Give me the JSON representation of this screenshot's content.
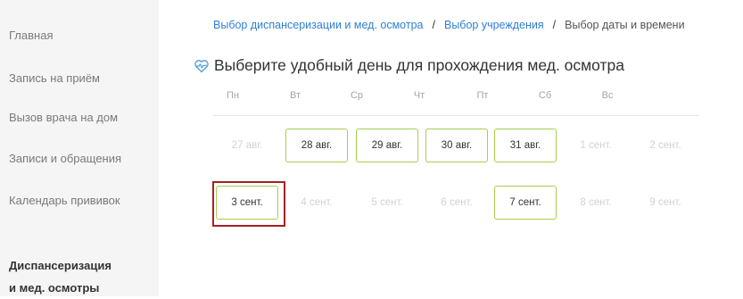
{
  "sidebar": {
    "items": [
      {
        "label": "Главная"
      },
      {
        "label": "Запись на приём"
      },
      {
        "label": "Вызов врача на дом"
      },
      {
        "label": "Записи и обращения"
      },
      {
        "label": "Календарь прививок"
      }
    ],
    "section": {
      "line1": "Диспансеризация",
      "line2": "и мед. осмотры"
    }
  },
  "breadcrumb": {
    "step1": "Выбор диспансеризации и мед. осмотра",
    "step2": "Выбор учреждения",
    "current": "Выбор даты и времени",
    "separator": "/"
  },
  "title": "Выберите удобный день для прохождения мед. осмотра",
  "calendar": {
    "weekdays": [
      "Пн",
      "Вт",
      "Ср",
      "Чт",
      "Пт",
      "Сб",
      "Вс"
    ],
    "weeks": [
      [
        {
          "label": "27 авг.",
          "state": "disabled"
        },
        {
          "label": "28 авг.",
          "state": "available"
        },
        {
          "label": "29 авг.",
          "state": "available"
        },
        {
          "label": "30 авг.",
          "state": "available"
        },
        {
          "label": "31 авг.",
          "state": "available"
        },
        {
          "label": "1 сент.",
          "state": "disabled"
        },
        {
          "label": "2 сент.",
          "state": "disabled"
        }
      ],
      [
        {
          "label": "3 сент.",
          "state": "available"
        },
        {
          "label": "4 сент.",
          "state": "disabled"
        },
        {
          "label": "5 сент.",
          "state": "disabled"
        },
        {
          "label": "6 сент.",
          "state": "disabled"
        },
        {
          "label": "7 сент.",
          "state": "available"
        },
        {
          "label": "8 сент.",
          "state": "disabled"
        },
        {
          "label": "9 сент.",
          "state": "disabled"
        }
      ]
    ]
  },
  "colors": {
    "link": "#2f7fd3",
    "available_border": "#a7cf4d",
    "highlight": "#a82025",
    "disabled_text": "#d2d2d2"
  },
  "icons": {
    "title": "heart-pulse-icon"
  }
}
